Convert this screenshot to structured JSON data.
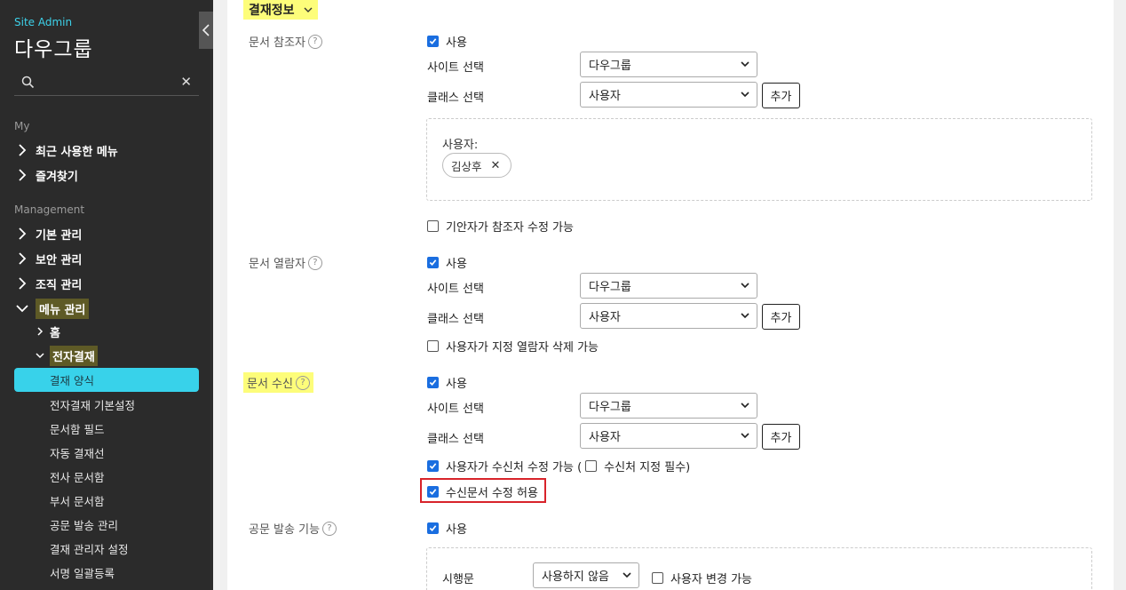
{
  "sidebar": {
    "site_admin": "Site Admin",
    "org_title": "다우그룹",
    "search_placeholder": "",
    "sections": {
      "my": "My",
      "management": "Management"
    },
    "my_items": [
      "최근 사용한 메뉴",
      "즐겨찾기"
    ],
    "mgmt_items": [
      "기본 관리",
      "보안 관리",
      "조직 관리",
      "메뉴 관리"
    ],
    "sub_items": [
      "홈",
      "전자결재"
    ],
    "leaves": [
      "결재 양식",
      "전자결재 기본설정",
      "문서함 필드",
      "자동 결재선",
      "전사 문서함",
      "부서 문서함",
      "공문 발송 관리",
      "결재 관리자 설정",
      "서명 일괄등록"
    ]
  },
  "content": {
    "section_title": "결재정보",
    "help_glyph": "?",
    "use_label": "사용",
    "site_select_label": "사이트 선택",
    "class_select_label": "클래스 선택",
    "site_value": "다우그룹",
    "class_value": "사용자",
    "add_button": "추가",
    "ref": {
      "label": "문서 참조자",
      "user_box_label": "사용자:",
      "user_tag": "김상후",
      "tag_remove": "✕",
      "drafter_edit": "기안자가 참조자 수정 가능"
    },
    "viewer": {
      "label": "문서 열람자",
      "delete_option": "사용자가 지정 열람자 삭제 가능"
    },
    "receive": {
      "label": "문서 수신",
      "user_edit": "사용자가 수신처 수정 가능 (",
      "required": "수신처 지정 필수)",
      "allow_edit": "수신문서 수정 허용"
    },
    "official": {
      "label": "공문 발송 기능",
      "exec_label": "시행문",
      "exec_value": "사용하지 않음",
      "user_change": "사용자 변경 가능"
    }
  }
}
